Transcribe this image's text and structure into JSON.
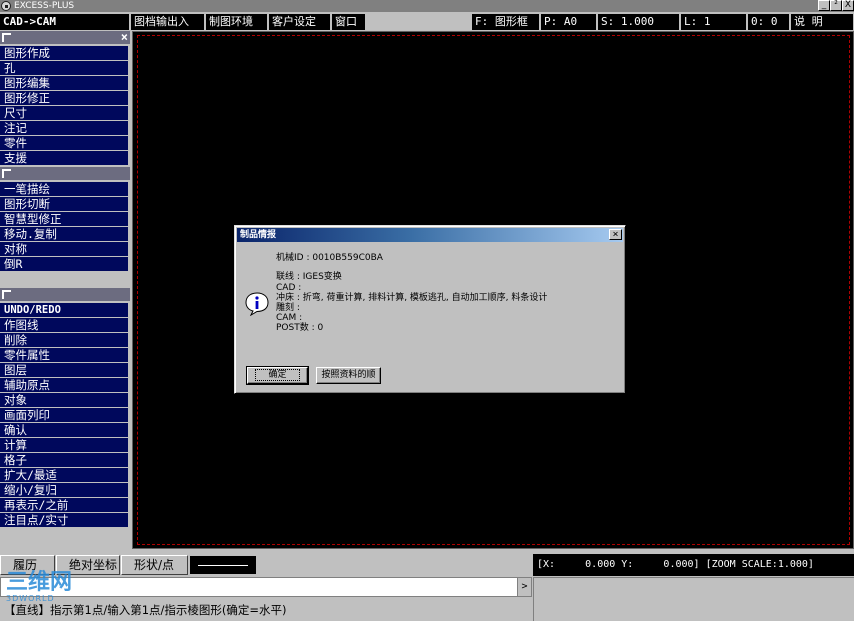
{
  "window": {
    "title": "EXCESS-PLUS",
    "minimize": "_",
    "restore": "²",
    "close": "X"
  },
  "menubar": {
    "mode": "CAD->CAM",
    "menus": [
      "图档输出入",
      "制图环境",
      "客户设定",
      "窗口"
    ],
    "status": {
      "layer": "F: 图形框",
      "page": "P: A0",
      "scale": "S: 1.000",
      "line": "L: 1",
      "other": "0: 0",
      "help": "说 明"
    }
  },
  "sidebar": {
    "close_label": "×",
    "group1": [
      "图形作成",
      "孔",
      "图形编集",
      "图形修正",
      "尺寸",
      "注记",
      "零件",
      "支援"
    ],
    "group2": [
      "一笔描绘",
      "图形切断",
      "智慧型修正",
      "移动.复制",
      "对称",
      "倒R"
    ],
    "group3_header": "UNDO/REDO",
    "group3": [
      "作图线",
      "削除",
      "零件属性",
      "图层",
      "辅助原点",
      "对象",
      "画面列印",
      "确认",
      "计算",
      "格子",
      "扩大/最适",
      "缩小/复归",
      "再表示/之前",
      "注目点/实寸"
    ]
  },
  "dialog": {
    "title": "制品情报",
    "close": "×",
    "machine_id": "机械ID : 0010B559C0BA",
    "lines": [
      "联线 : IGES变换",
      "CAD :",
      "冲床 : 折弯, 荷重计算, 排料计算, 模板逃孔, 自动加工顺序, 料条设计",
      "雕刻 :",
      "CAM :",
      "POST数 : 0"
    ],
    "ok_label": "确定",
    "second_button": "按照资料的顺",
    "icon": "info-icon"
  },
  "bottom": {
    "tabs": [
      "履历",
      "绝对坐标",
      "形状/点"
    ],
    "coords": "[X:     0.000 Y:     0.000] [ZOOM SCALE:1.000]",
    "scroll_arrow": ">",
    "status": "【直线】指示第1点/输入第1点/指示棱图形(确定=水平)"
  },
  "watermark": {
    "text": "三维网",
    "sub": "3DWORLD"
  },
  "colors": {
    "sidebar_item": "#00085c",
    "canvas": "#000000",
    "dialog_title_start": "#0a246a",
    "dialog_title_end": "#a6caf0",
    "guide": "#b00000"
  }
}
